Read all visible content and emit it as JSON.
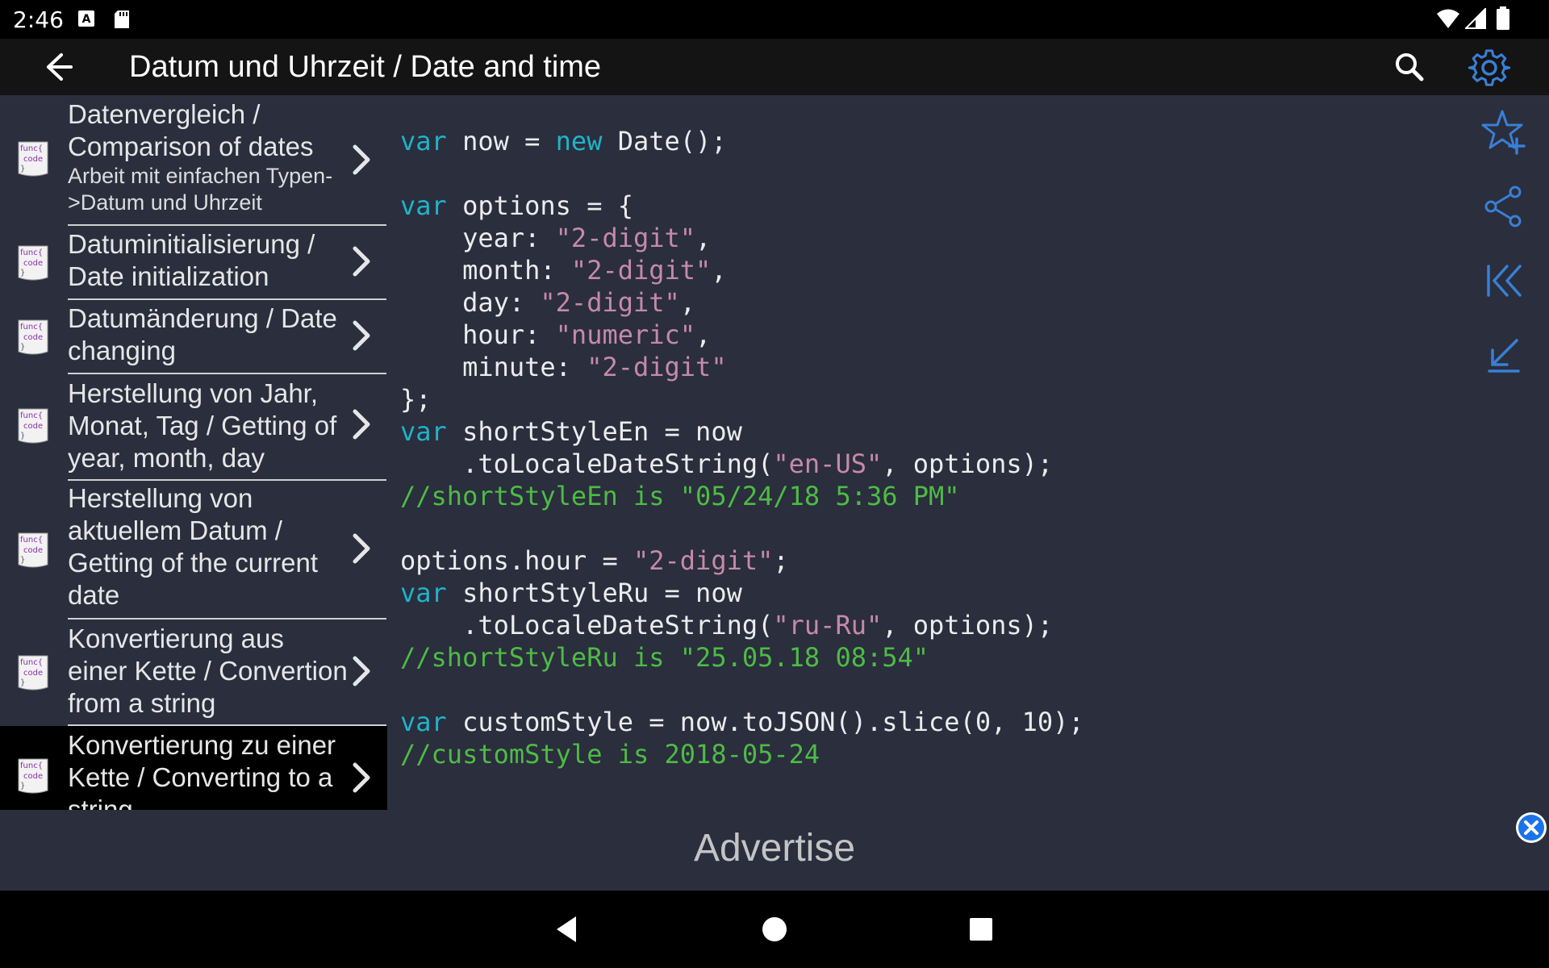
{
  "status_bar": {
    "time": "2:46",
    "icons": [
      "font-notification-icon",
      "sd-card-icon",
      "wifi-icon",
      "signal-icon",
      "battery-icon"
    ]
  },
  "app_bar": {
    "title": "Datum und Uhrzeit / Date and time",
    "icons": [
      "back-arrow-icon",
      "search-icon",
      "gear-icon"
    ],
    "accent": "#3a7fd5"
  },
  "sidebar": {
    "icon_label": "func{ code }",
    "items": [
      {
        "title": "Datenvergleich / Comparison of dates",
        "subtitle": "Arbeit mit einfachen Typen->Datum und Uhrzeit"
      },
      {
        "title": "Datuminitialisierung / Date initialization"
      },
      {
        "title": "Datumänderung / Date changing"
      },
      {
        "title": "Herstellung von Jahr, Monat, Tag / Getting of year, month, day"
      },
      {
        "title": "Herstellung von aktuellem Datum / Getting of the current date"
      },
      {
        "title": "Konvertierung aus einer Kette / Convertion from a string"
      },
      {
        "title": "Konvertierung zu einer Kette / Converting to a string",
        "active": true
      }
    ]
  },
  "code": {
    "lines": [
      [
        [
          "kw",
          "var"
        ],
        [
          "t",
          " now = "
        ],
        [
          "kw",
          "new"
        ],
        [
          "t",
          " Date();"
        ]
      ],
      [],
      [
        [
          "kw",
          "var"
        ],
        [
          "t",
          " options = {"
        ]
      ],
      [
        [
          "t",
          "    year: "
        ],
        [
          "str",
          "\"2-digit\""
        ],
        [
          "t",
          ","
        ]
      ],
      [
        [
          "t",
          "    month: "
        ],
        [
          "str",
          "\"2-digit\""
        ],
        [
          "t",
          ","
        ]
      ],
      [
        [
          "t",
          "    day: "
        ],
        [
          "str",
          "\"2-digit\""
        ],
        [
          "t",
          ","
        ]
      ],
      [
        [
          "t",
          "    hour: "
        ],
        [
          "str",
          "\"numeric\""
        ],
        [
          "t",
          ","
        ]
      ],
      [
        [
          "t",
          "    minute: "
        ],
        [
          "str",
          "\"2-digit\""
        ]
      ],
      [
        [
          "t",
          "};"
        ]
      ],
      [
        [
          "kw",
          "var"
        ],
        [
          "t",
          " shortStyleEn = now"
        ]
      ],
      [
        [
          "t",
          "    .toLocaleDateString("
        ],
        [
          "str",
          "\"en-US\""
        ],
        [
          "t",
          ", options);"
        ]
      ],
      [
        [
          "cm",
          "//shortStyleEn is \"05/24/18 5:36 PM\""
        ]
      ],
      [],
      [
        [
          "t",
          "options.hour = "
        ],
        [
          "str",
          "\"2-digit\""
        ],
        [
          "t",
          ";"
        ]
      ],
      [
        [
          "kw",
          "var"
        ],
        [
          "t",
          " shortStyleRu = now"
        ]
      ],
      [
        [
          "t",
          "    .toLocaleDateString("
        ],
        [
          "str",
          "\"ru-Ru\""
        ],
        [
          "t",
          ", options);"
        ]
      ],
      [
        [
          "cm",
          "//shortStyleRu is \"25.05.18 08:54\""
        ]
      ],
      [],
      [
        [
          "kw",
          "var"
        ],
        [
          "t",
          " customStyle = now.toJSON().slice(0, 10);"
        ]
      ],
      [
        [
          "cm",
          "//customStyle is 2018-05-24"
        ]
      ]
    ],
    "colors": {
      "keyword": "#1fb3c9",
      "string": "#c58aa7",
      "comment": "#4ebb45"
    }
  },
  "toolbar": {
    "icons": [
      "star-add-icon",
      "share-icon",
      "first-page-icon",
      "bottom-arrow-icon"
    ]
  },
  "ad": {
    "label": "Advertise",
    "close_icon": "close-icon"
  },
  "nav_bar": {
    "icons": [
      "back-triangle-icon",
      "home-circle-icon",
      "recents-square-icon"
    ]
  }
}
